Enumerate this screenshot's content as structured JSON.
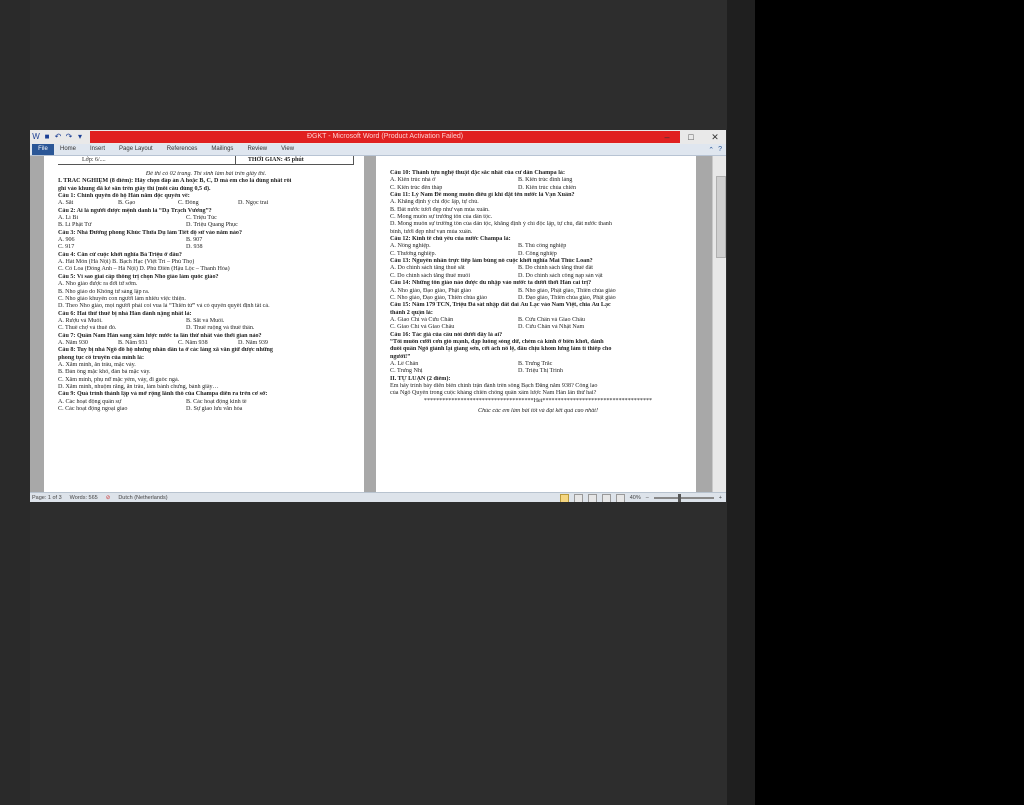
{
  "window": {
    "title": "ĐGKT - Microsoft Word (Product Activation Failed)",
    "controls": {
      "minimize": "–",
      "maximize": "□",
      "close": "✕"
    }
  },
  "ribbon": {
    "file": "File",
    "tabs": [
      "Home",
      "Insert",
      "Page Layout",
      "References",
      "Mailings",
      "Review",
      "View"
    ]
  },
  "status": {
    "page": "Page: 1 of 3",
    "words": "Words: 565",
    "language": "Dutch (Netherlands)",
    "zoom": "40%"
  },
  "left_page": {
    "header_left": "Lớp: 6/....",
    "header_right": "THỜI GIAN: 45 phút",
    "note": "Đề thi có 02 trang. Thí sinh làm bài trên giấy thi.",
    "section1": "I. TRẮC NGHIỆM (8 điểm): Hãy chọn đáp án A hoặc B, C, D mà em cho là đúng nhất rồi",
    "section1b": "ghi vào khung đã kẻ sẵn trên giấy thi (mỗi câu đúng 0,5 đ).",
    "q1": "Câu 1: Chính quyền đô hộ Hán nằm độc quyền về:",
    "q1_opts": [
      "A. Sắt",
      "B. Gạo",
      "C. Đồng",
      "D. Ngọc trai"
    ],
    "q2": "Câu 2: Ai là người được mệnh danh là “Dạ Trạch Vương”?",
    "q2_a": "A. Lí Bí",
    "q2_b": "C. Triệu Túc",
    "q2_c": "B. Lí Phật Tử",
    "q2_d": "D. Triệu Quang Phục",
    "q3": "Câu 3: Nhà Đường phong Khúc Thừa Dụ làm Tiết độ sứ vào năm nào?",
    "q3_a": "A. 906",
    "q3_b": "B. 907",
    "q3_c": "C. 917",
    "q3_d": "D. 938",
    "q4": "Câu 4: Căn cứ cuộc khởi nghĩa Bà Triệu ở đâu?",
    "q4_l1": "A. Hát Môn (Hà Nội)   B. Bạch Hạc (Việt Trì – Phú Thọ)",
    "q4_l2": "C. Cổ Loa  (Đông Anh – Hà Nội)            D. Phú Điền (Hậu Lộc – Thanh Hóa)",
    "q5": "Câu 5: Vì sao giai cấp thống trị chọn Nho giáo làm quốc giáo?",
    "q5_a": "A. Nho giáo được ra đời từ sớm.",
    "q5_b": "B. Nho giáo do Khổng tử sáng lập ra.",
    "q5_c": "C. Nho giáo khuyến con người làm nhiều việc thiện.",
    "q5_d": "D. Theo Nho giáo, mọi người phải coi vua là “Thiên tử” và có quyền quyết định tất cả.",
    "q6": "Câu 6: Hai thứ thuế bị nhà Hán đánh nặng nhất là:",
    "q6_a": "A. Rượu và Muối.",
    "q6_b": "B. Sắt và Muối.",
    "q6_c": "C. Thuế chợ và thuế đò.",
    "q6_d": "D. Thuế ruộng và thuế thân.",
    "q7": "Câu 7: Quân Nam Hán sang xâm lược nước ta lần thứ nhất vào thời gian nào?",
    "q7_opts": [
      "A.  Năm 930",
      "B.  Năm 931",
      "C.  Năm 938",
      "D.  Năm 939"
    ],
    "q8": "Câu 8: Tuy bị nhà Ngô đô hộ nhưng nhân dân ta ở các làng xã vẫn giữ được những",
    "q8b": "phong tục cổ truyền của mình là:",
    "q8_a": "A. Xăm mình, ăn trầu, mặc váy.",
    "q8_b": "B. Đàn ông mặc khố, đàn bà mặc váy.",
    "q8_c": "C. Xăm mình, phụ nữ mặc yếm, váy, đi guốc ngà.",
    "q8_d": "D. Xăm mình, nhuộm răng, ăn trầu, làm bánh chưng, bánh giầy…",
    "q9": "Câu 9: Quá trình thành lập và mở rộng lãnh thổ của Champa diễn ra trên cơ sở:",
    "q9_a": "A.  Các hoạt động quân sự",
    "q9_b": "B. Các hoạt động kinh tế",
    "q9_c": "C.  Các hoạt động ngoại giao",
    "q9_d": "D. Sự giao lưu văn hóa"
  },
  "right_page": {
    "q10": "Câu 10:  Thành tựu nghệ thuật đặc sắc nhất của cư dân Champa là:",
    "q10_a": "A. Kiến trúc nhà ở",
    "q10_b": "B. Kiến trúc đình làng",
    "q10_c": "C. Kiến trúc đền tháp",
    "q10_d": "D. Kiến trúc chùa chiền",
    "q11": "Câu 11: Lý Nam Đế mong muốn điều gì khi đặt tên nước là Vạn Xuân?",
    "q11_a": "A. Khẳng định ý chí độc lập, tự chủ.",
    "q11_b": "B. Đất nước tươi đẹp như vạn mùa xuân.",
    "q11_c": "C. Mong muốn sự trường tồn của dân tộc.",
    "q11_d": "D. Mong muốn sự trường tồn của dân tộc, khẳng định ý chí độc lập, tự chủ, đất nước thanh",
    "q11_d2": "bình, tươi đẹp như vạn mùa xuân.",
    "q12": "Câu 12: Kinh tế chủ yếu của nước Champa là:",
    "q12_a": "A. Nông nghiệp.",
    "q12_b": "B. Thủ công nghiệp",
    "q12_c": "C. Thương nghiệp.",
    "q12_d": "D. Công nghiệp",
    "q13": "Câu 13: Nguyên nhân trực tiếp làm bùng nổ cuộc khởi nghĩa Mai Thúc Loan?",
    "q13_a": "A. Do chính sách tăng thuế sắt",
    "q13_b": "B. Do chính sách tăng thuế đất",
    "q13_c": "C. Do chính sách tăng thuế muối",
    "q13_d": "D. Do chính sách cống nạp sản vật",
    "q14": "Câu 14: Những tôn giáo nào được du nhập vào nước ta dưới thời Hán cai trị?",
    "q14_a": "A. Nho giáo, Đạo giáo, Phật giáo",
    "q14_b": "B. Nho giáo, Phật giáo, Thiên chúa giáo",
    "q14_c": "C. Nho giáo, Đạo giáo, Thiên chúa giáo",
    "q14_d": "D. Đạo giáo, Thiên chúa giáo, Phật giáo",
    "q15": "Câu 15: Năm 179 TCN, Triệu Đà sát nhập đất đai Âu Lạc vào Nam Việt, chia Âu Lạc",
    "q15b": "thành 2 quận là:",
    "q15_a": "A. Giao Chỉ và Cửu Chân",
    "q15_b": "B. Cửu Chân và Giao Châu",
    "q15_c": "C. Giao Chỉ và Giao Châu",
    "q15_d": "D. Cửu Chân và Nhật Nam",
    "q16": "Câu 16: Tác giả của câu nói dưới đây là ai?",
    "q16_quote1": "“Tôi muốn cưỡi cơn gió mạnh, đạp luồng sóng dữ, chém cá kình ở biển khơi, đánh",
    "q16_quote2": "đuổi quân Ngô giành lại giang sơn, cởi ách nô lệ, đâu chịu khom lưng làm tì thiếp cho",
    "q16_quote3": "người!”",
    "q16_a": "A. Lê Chân",
    "q16_b": "B. Trưng Trắc",
    "q16_c": "C. Trưng Nhị",
    "q16_d": "D. Triệu Thị Trinh",
    "section2": "II. TỰ LUẬN (2 điểm):",
    "essay1": "      Em hãy trình bày diễn biến chính trận đánh trên sông Bạch Đằng năm 938? Công lao",
    "essay2": "của Ngô Quyền trong cuộc kháng chiến chống quân xâm lược Nam Hán lần thứ hai?",
    "stars": "************************************Hết************************************",
    "ending": "Chúc các em làm bài tốt và đạt kết quả cao nhất!"
  }
}
